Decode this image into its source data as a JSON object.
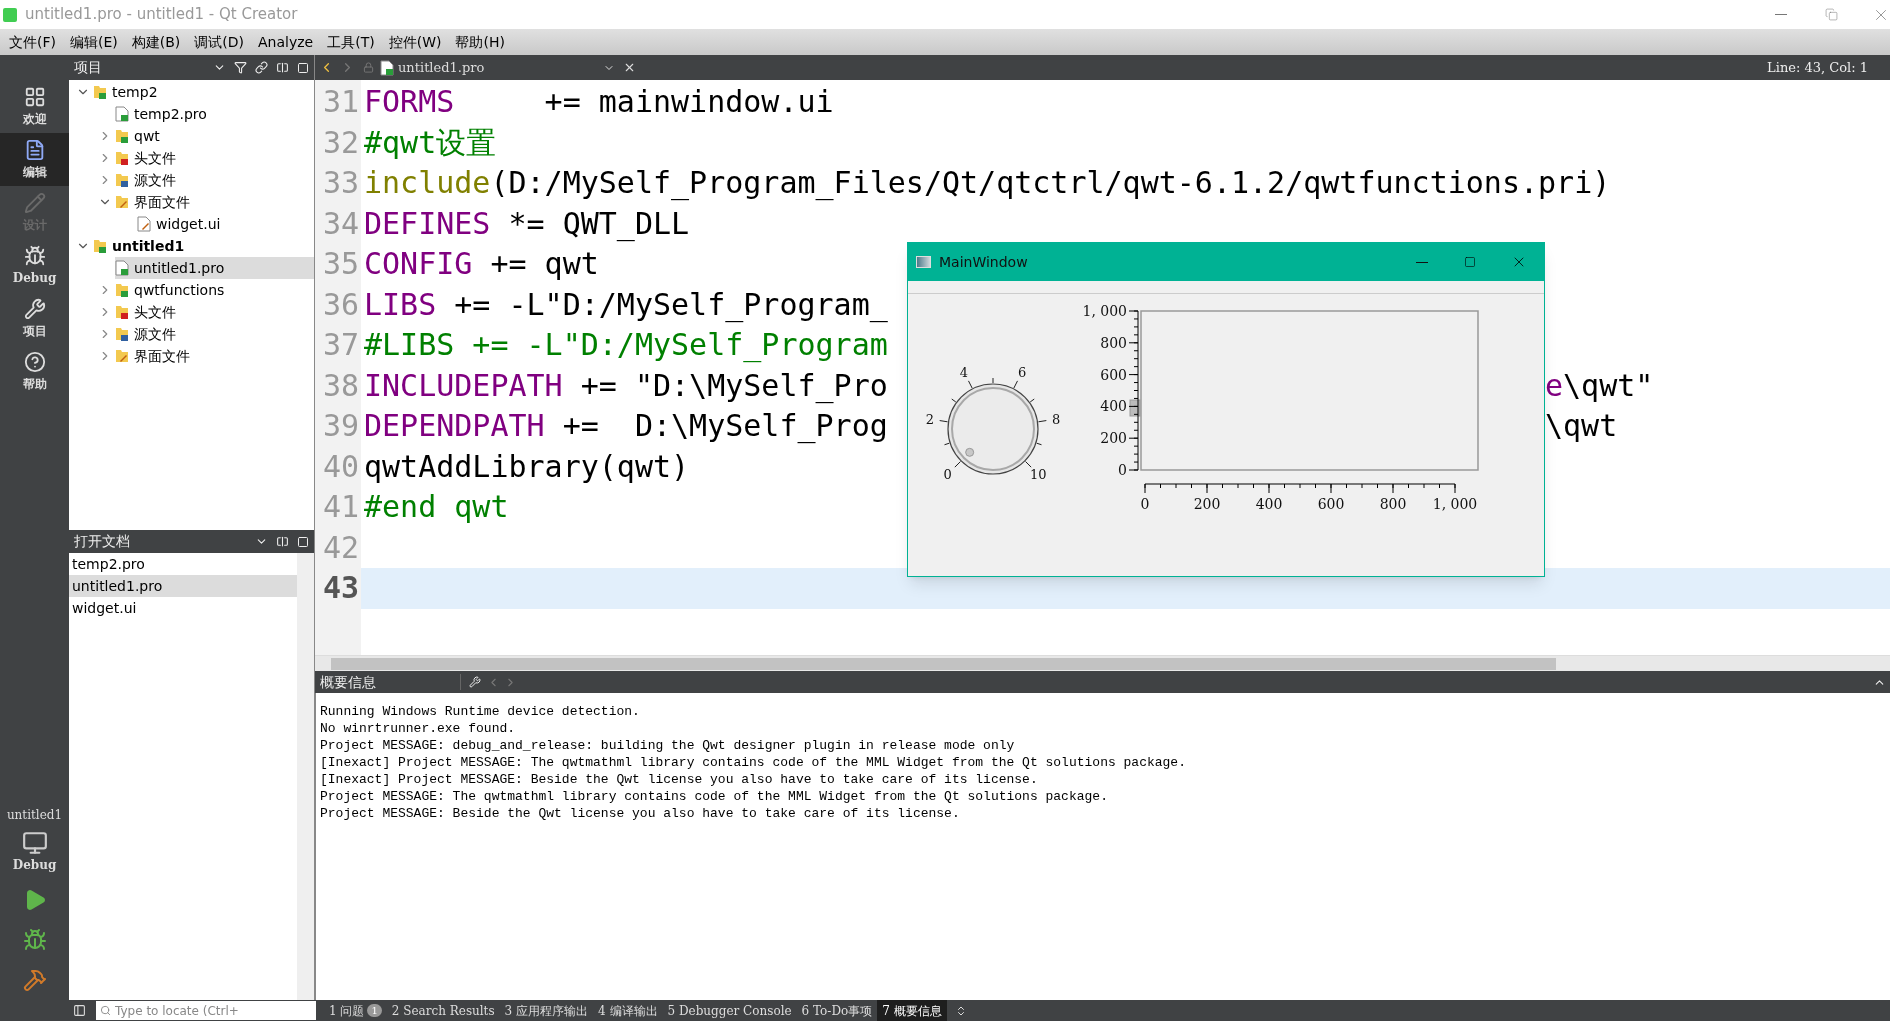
{
  "window": {
    "title": "untitled1.pro - untitled1 - Qt Creator"
  },
  "menu": [
    "文件(F)",
    "编辑(E)",
    "构建(B)",
    "调试(D)",
    "Analyze",
    "工具(T)",
    "控件(W)",
    "帮助(H)"
  ],
  "modes": [
    {
      "kind": "welcome",
      "label": "欢迎",
      "selected": false,
      "disabled": false
    },
    {
      "kind": "edit",
      "label": "编辑",
      "selected": true,
      "disabled": false
    },
    {
      "kind": "design",
      "label": "设计",
      "selected": false,
      "disabled": true
    },
    {
      "kind": "debug",
      "label": "Debug",
      "selected": false,
      "disabled": false
    },
    {
      "kind": "projects",
      "label": "项目",
      "selected": false,
      "disabled": false
    },
    {
      "kind": "help",
      "label": "帮助",
      "selected": false,
      "disabled": false
    }
  ],
  "target": {
    "project": "untitled1",
    "config": "Debug"
  },
  "projects_panel": {
    "title": "项目",
    "tree": [
      {
        "label": "temp2",
        "kind": "project",
        "active": false,
        "expanded": true,
        "selected": false,
        "children": [
          {
            "label": "temp2.pro",
            "kind": "pro",
            "selected": false
          },
          {
            "label": "qwt",
            "kind": "qt-folder",
            "expanded": false,
            "selected": false
          },
          {
            "label": "头文件",
            "kind": "h-folder",
            "expanded": false,
            "selected": false
          },
          {
            "label": "源文件",
            "kind": "cpp-folder",
            "expanded": false,
            "selected": false
          },
          {
            "label": "界面文件",
            "kind": "ui-folder",
            "expanded": true,
            "selected": false,
            "children": [
              {
                "label": "widget.ui",
                "kind": "ui",
                "selected": false
              }
            ]
          }
        ]
      },
      {
        "label": "untitled1",
        "kind": "project",
        "active": true,
        "expanded": true,
        "selected": false,
        "children": [
          {
            "label": "untitled1.pro",
            "kind": "pro",
            "selected": true
          },
          {
            "label": "qwtfunctions",
            "kind": "qt-folder",
            "expanded": false,
            "selected": false
          },
          {
            "label": "头文件",
            "kind": "h-folder",
            "expanded": false,
            "selected": false
          },
          {
            "label": "源文件",
            "kind": "cpp-folder",
            "expanded": false,
            "selected": false
          },
          {
            "label": "界面文件",
            "kind": "ui-folder",
            "expanded": false,
            "selected": false
          }
        ]
      }
    ]
  },
  "open_documents": {
    "title": "打开文档",
    "items": [
      {
        "label": "temp2.pro",
        "selected": false
      },
      {
        "label": "untitled1.pro",
        "selected": true
      },
      {
        "label": "widget.ui",
        "selected": false
      }
    ]
  },
  "editor": {
    "tab": "untitled1.pro",
    "position": "Line: 43, Col: 1",
    "lines": [
      {
        "number": "31",
        "current": false,
        "segments": [
          {
            "text": "FORMS",
            "kind": "keyword"
          },
          {
            "text": "     += mainwindow.ui",
            "kind": "plain"
          }
        ]
      },
      {
        "number": "32",
        "current": false,
        "segments": [
          {
            "text": "#qwt设置",
            "kind": "comment"
          }
        ]
      },
      {
        "number": "33",
        "current": false,
        "segments": [
          {
            "text": "include",
            "kind": "function"
          },
          {
            "text": "(D:/MySelf_Program_Files/Qt/qtctrl/qwt-6.1.2/qwtfunctions.pri)",
            "kind": "plain"
          }
        ]
      },
      {
        "number": "34",
        "current": false,
        "segments": [
          {
            "text": "DEFINES",
            "kind": "keyword"
          },
          {
            "text": " *= QWT_DLL",
            "kind": "plain"
          }
        ]
      },
      {
        "number": "35",
        "current": false,
        "segments": [
          {
            "text": "CONFIG",
            "kind": "keyword"
          },
          {
            "text": " += qwt",
            "kind": "plain"
          }
        ]
      },
      {
        "number": "36",
        "current": false,
        "segments": [
          {
            "text": "LIBS",
            "kind": "keyword"
          },
          {
            "text": " += -L\"D:/MySelf_Program_",
            "kind": "plain"
          }
        ]
      },
      {
        "number": "37",
        "current": false,
        "segments": [
          {
            "text": "#LIBS += -L\"D:/MySelf_Program",
            "kind": "comment"
          }
        ]
      },
      {
        "number": "38",
        "current": false,
        "segments": [
          {
            "text": "INCLUDEPATH",
            "kind": "keyword"
          },
          {
            "text": " += \"D:\\MySelf_Pro",
            "kind": "plain"
          }
        ],
        "tail": [
          {
            "text": "e",
            "kind": "keyword"
          },
          {
            "text": "\\qwt\"",
            "kind": "plain"
          }
        ]
      },
      {
        "number": "39",
        "current": false,
        "segments": [
          {
            "text": "DEPENDPATH",
            "kind": "keyword"
          },
          {
            "text": " +=  D:\\MySelf_Prog",
            "kind": "plain"
          }
        ],
        "tail": [
          {
            "text": "\\qwt",
            "kind": "plain"
          }
        ]
      },
      {
        "number": "40",
        "current": false,
        "segments": [
          {
            "text": "qwtAddLibrary(qwt)",
            "kind": "plain"
          }
        ]
      },
      {
        "number": "41",
        "current": false,
        "segments": [
          {
            "text": "#end qwt",
            "kind": "comment"
          }
        ]
      },
      {
        "number": "42",
        "current": false
      },
      {
        "number": "43",
        "current": true
      }
    ]
  },
  "main_window": {
    "title": "MainWindow",
    "dial": {
      "labels": [
        "0",
        "2",
        "4",
        "6",
        "8",
        "10"
      ]
    },
    "chart_data": {
      "type": "line",
      "xlim": [
        0,
        1000
      ],
      "ylim": [
        0,
        1000
      ],
      "xticks": [
        0,
        200,
        400,
        600,
        800,
        {
          "value": 1000,
          "label": "1, 000"
        }
      ],
      "yticks": [
        0,
        200,
        400,
        600,
        800,
        {
          "value": 1000,
          "label": "1, 000"
        }
      ]
    }
  },
  "output": {
    "title": "概要信息",
    "lines": [
      "Running Windows Runtime device detection.",
      "No winrtrunner.exe found.",
      "Project MESSAGE: debug_and_release: building the Qwt designer plugin in release mode only",
      "[Inexact] Project MESSAGE: The qwtmathml library contains code of the MML Widget from the Qt solutions package.",
      "[Inexact] Project MESSAGE: Beside the Qwt license you also have to take care of its license.",
      "Project MESSAGE: The qwtmathml library contains code of the MML Widget from the Qt solutions package.",
      "Project MESSAGE: Beside the Qwt license you also have to take care of its license."
    ]
  },
  "status_bar": {
    "locate_placeholder": "Type to locate (Ctrl+",
    "panes": [
      {
        "label": "1 问题",
        "badge": "1",
        "selected": false
      },
      {
        "label": "2 Search Results",
        "selected": false
      },
      {
        "label": "3 应用程序输出",
        "selected": false
      },
      {
        "label": "4 编译输出",
        "selected": false
      },
      {
        "label": "5 Debugger Console",
        "selected": false
      },
      {
        "label": "6 To-Do事项",
        "selected": false
      },
      {
        "label": "7 概要信息",
        "selected": true
      }
    ]
  }
}
